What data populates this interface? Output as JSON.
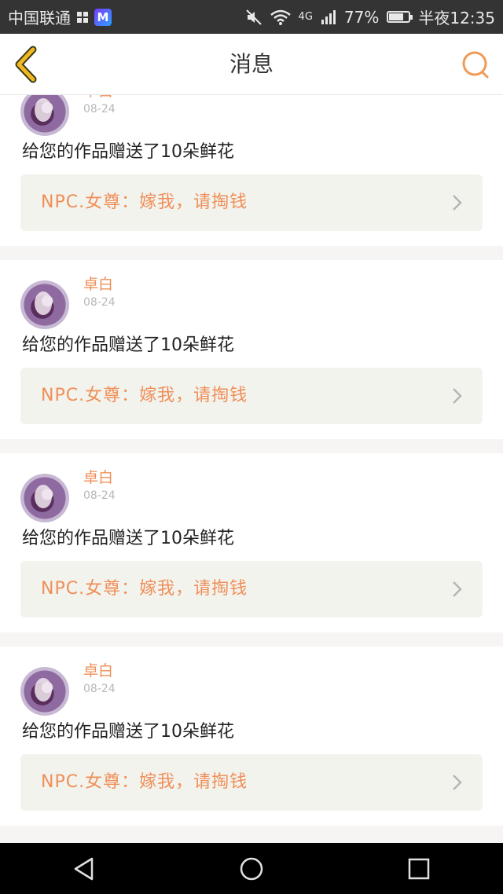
{
  "status_bar": {
    "carrier": "中国联通",
    "network": "4G",
    "battery_percent": "77%",
    "time": "半夜12:35",
    "battery_fill_fraction": 0.77
  },
  "header": {
    "title": "消息"
  },
  "messages": [
    {
      "username": "卓白",
      "date": "08-24",
      "text": "给您的作品赠送了10朵鲜花",
      "quote": "NPC.女尊：嫁我，请掏钱"
    },
    {
      "username": "卓白",
      "date": "08-24",
      "text": "给您的作品赠送了10朵鲜花",
      "quote": "NPC.女尊：嫁我，请掏钱"
    },
    {
      "username": "卓白",
      "date": "08-24",
      "text": "给您的作品赠送了10朵鲜花",
      "quote": "NPC.女尊：嫁我，请掏钱"
    },
    {
      "username": "卓白",
      "date": "08-24",
      "text": "给您的作品赠送了10朵鲜花",
      "quote": "NPC.女尊：嫁我，请掏钱"
    }
  ],
  "colors": {
    "accent": "#ef8f58",
    "back_icon": "#f0b821",
    "quote_bg": "#f3f3ee"
  },
  "icons": [
    "back-arrow-icon",
    "search-icon",
    "chevron-right-icon",
    "nav-back-icon",
    "nav-home-icon",
    "nav-recent-icon"
  ]
}
